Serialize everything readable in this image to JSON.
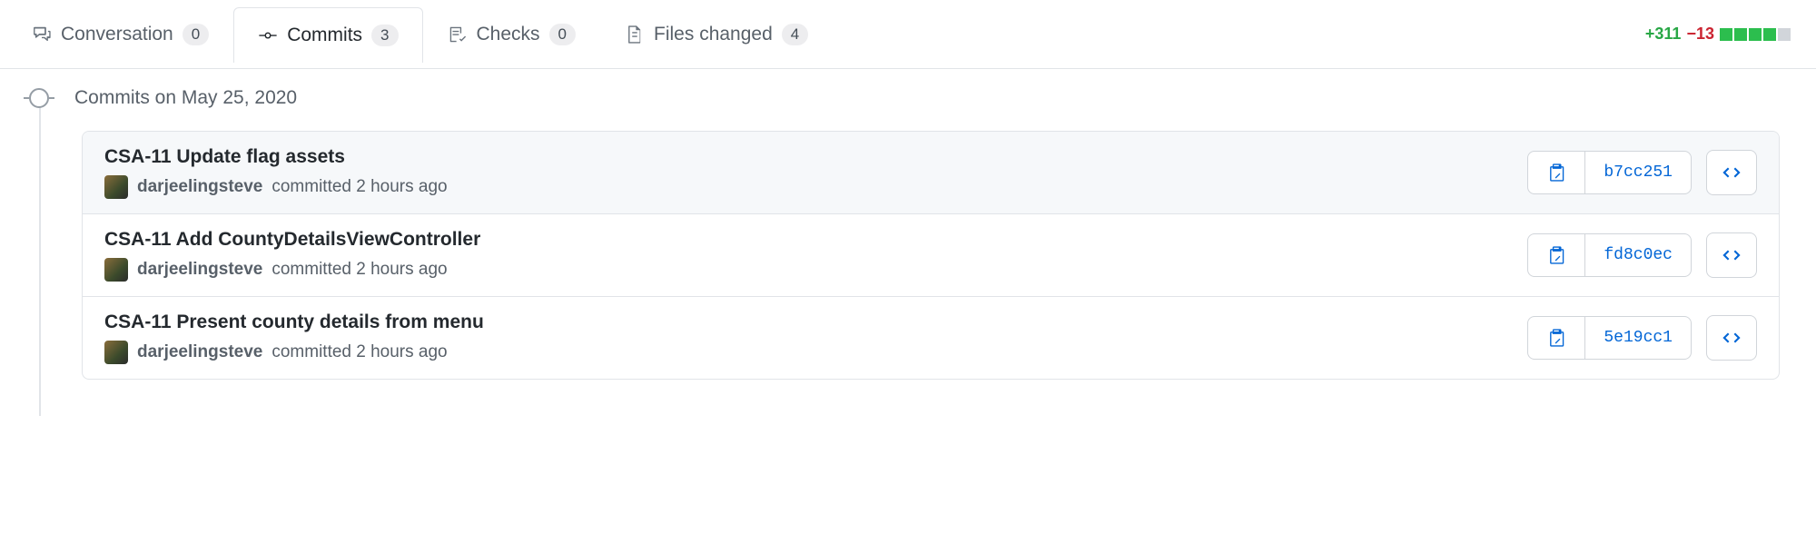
{
  "tabs": {
    "conversation": {
      "label": "Conversation",
      "count": "0"
    },
    "commits": {
      "label": "Commits",
      "count": "3"
    },
    "checks": {
      "label": "Checks",
      "count": "0"
    },
    "files": {
      "label": "Files changed",
      "count": "4"
    }
  },
  "diffstat": {
    "additions": "+311",
    "deletions": "−13"
  },
  "group": {
    "title": "Commits on May 25, 2020"
  },
  "commits": [
    {
      "title": "CSA-11 Update flag assets",
      "author": "darjeelingsteve",
      "meta_suffix": "committed 2 hours ago",
      "sha": "b7cc251"
    },
    {
      "title": "CSA-11 Add CountyDetailsViewController",
      "author": "darjeelingsteve",
      "meta_suffix": "committed 2 hours ago",
      "sha": "fd8c0ec"
    },
    {
      "title": "CSA-11 Present county details from menu",
      "author": "darjeelingsteve",
      "meta_suffix": "committed 2 hours ago",
      "sha": "5e19cc1"
    }
  ]
}
